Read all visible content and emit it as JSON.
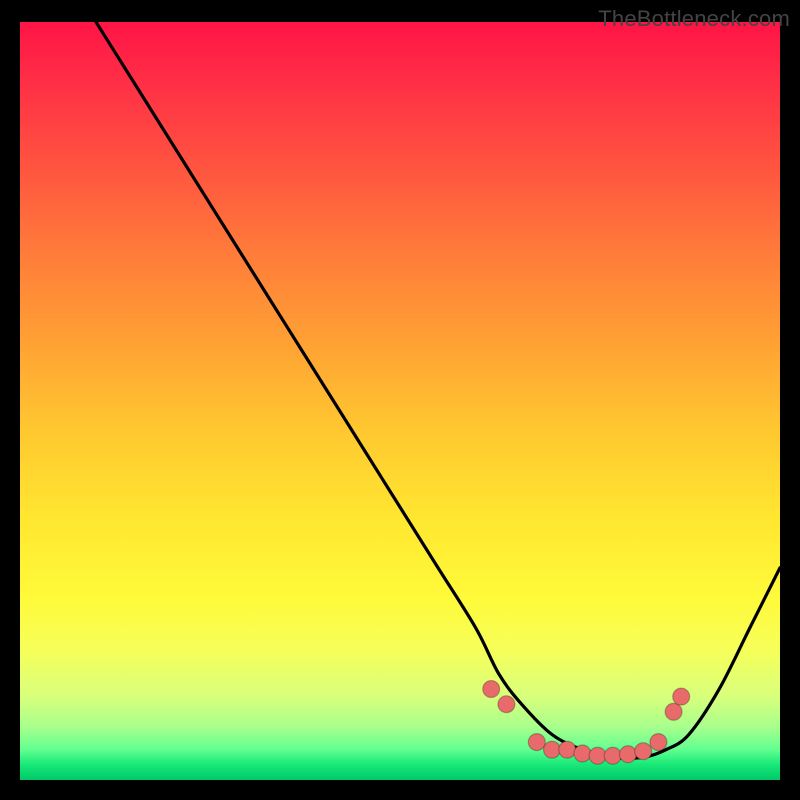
{
  "watermark": "TheBottleneck.com",
  "chart_data": {
    "type": "line",
    "title": "",
    "xlabel": "",
    "ylabel": "",
    "xlim": [
      0,
      100
    ],
    "ylim": [
      0,
      100
    ],
    "series": [
      {
        "name": "bottleneck-curve",
        "x": [
          10,
          15,
          20,
          25,
          30,
          35,
          40,
          45,
          50,
          55,
          60,
          63,
          66,
          70,
          74,
          78,
          82,
          85,
          88,
          92,
          96,
          100
        ],
        "y": [
          100,
          92,
          84,
          76,
          68,
          60,
          52,
          44,
          36,
          28,
          20,
          14,
          10,
          6,
          4,
          3,
          3,
          4,
          6,
          12,
          20,
          28
        ]
      }
    ],
    "markers": {
      "name": "highlight-dots",
      "x": [
        62,
        64,
        68,
        70,
        72,
        74,
        76,
        78,
        80,
        82,
        84,
        86,
        87
      ],
      "y": [
        12,
        10,
        5,
        4,
        4,
        3.5,
        3.2,
        3.2,
        3.4,
        3.8,
        5,
        9,
        11
      ]
    },
    "gradient_colors": {
      "top": "#ff1446",
      "mid": "#ffe830",
      "bottom": "#00c96a"
    }
  }
}
